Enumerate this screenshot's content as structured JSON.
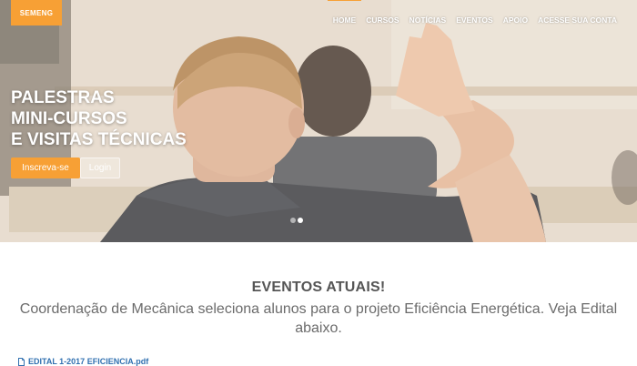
{
  "header": {
    "logo_text": "SEMENG",
    "nav": [
      {
        "label": "HOME",
        "active": true
      },
      {
        "label": "CURSOS",
        "active": false
      },
      {
        "label": "NOTÍCIAS",
        "active": false
      },
      {
        "label": "EVENTOS",
        "active": false
      },
      {
        "label": "APOIO",
        "active": false
      },
      {
        "label": "ACESSE SUA CONTA",
        "active": false
      }
    ]
  },
  "hero": {
    "headline": [
      "PALESTRAS",
      "MINI-CURSOS",
      "E VISITAS TÉCNICAS"
    ],
    "primary_button": "Inscreva-se",
    "secondary_button": "Login",
    "slides": 2,
    "active_slide": 2
  },
  "section": {
    "title": "EVENTOS ATUAIS!",
    "text": "Coordenação de Mecânica seleciona alunos para o projeto Eficiência Energética. Veja Edital abaixo."
  },
  "attachment": {
    "label": "EDITAL 1-2017 EFICIENCIA.pdf",
    "icon": "file-icon"
  },
  "colors": {
    "accent": "#f7a035",
    "link": "#3070b0",
    "text": "#6b6b6b"
  }
}
